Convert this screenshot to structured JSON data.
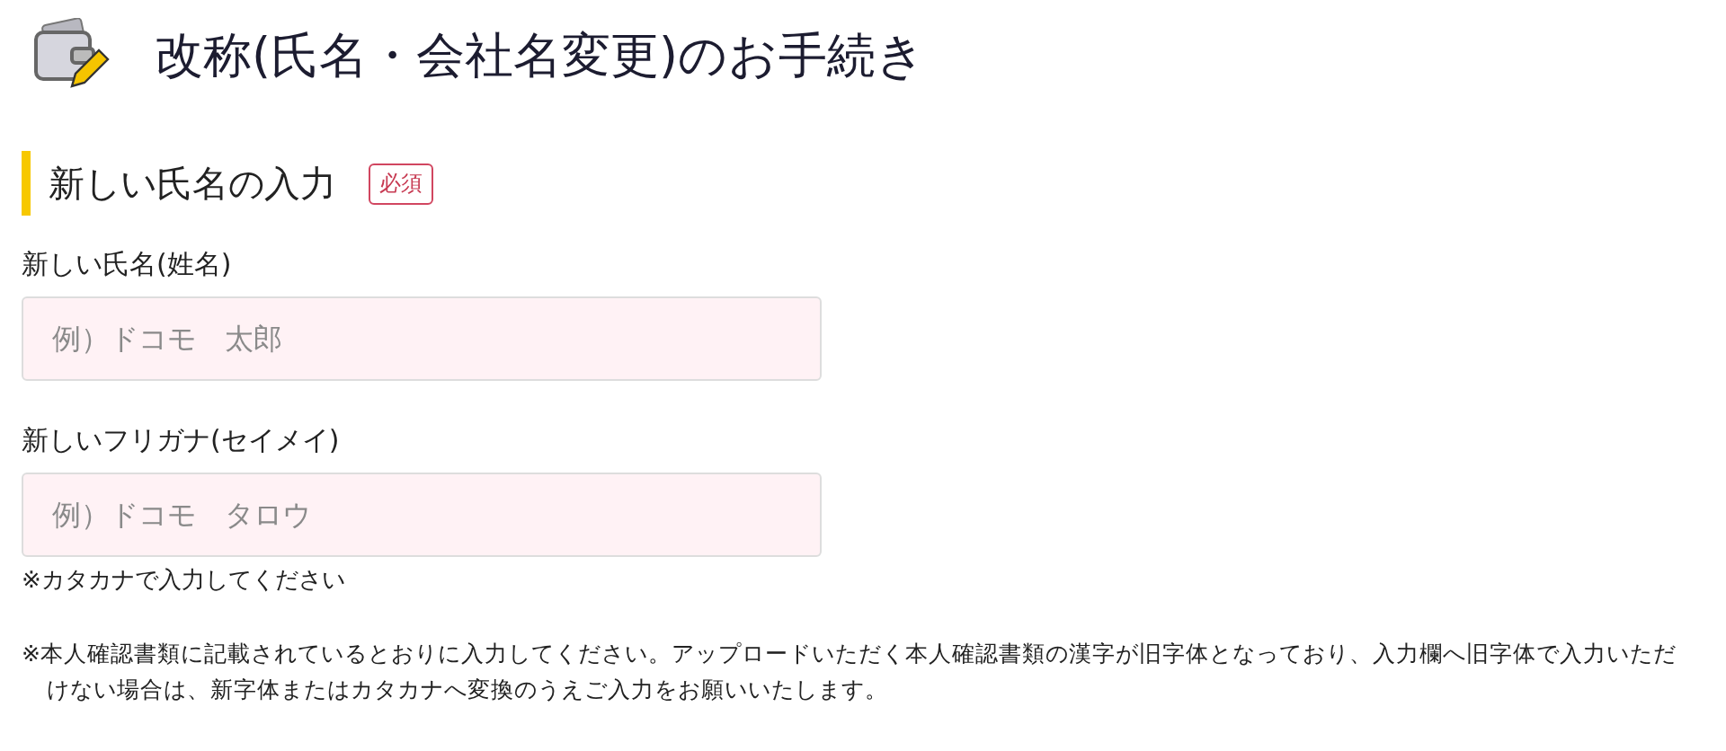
{
  "page_title": "改称(氏名・会社名変更)のお手続き",
  "section": {
    "title": "新しい氏名の入力",
    "badge": "必須"
  },
  "fields": [
    {
      "label": "新しい氏名(姓名)",
      "placeholder": "例）ドコモ　太郎"
    },
    {
      "label": "新しいフリガナ(セイメイ)",
      "placeholder": "例）ドコモ　タロウ",
      "hint": "※カタカナで入力してください"
    }
  ],
  "note": "※本人確認書類に記載されているとおりに入力してください。アップロードいただく本人確認書類の漢字が旧字体となっており、入力欄へ旧字体で入力いただけない場合は、新字体またはカタカナへ変換のうえご入力をお願いいたします。"
}
